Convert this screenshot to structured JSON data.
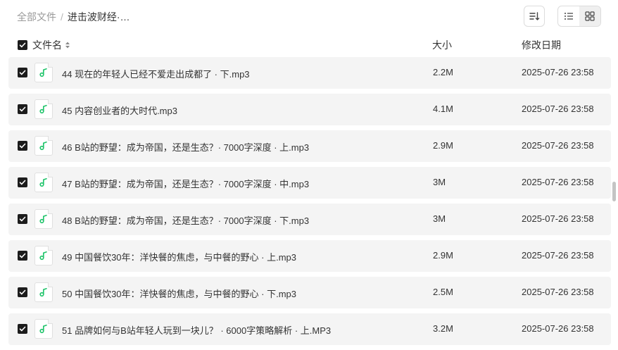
{
  "breadcrumb": {
    "root": "全部文件",
    "separator": "/",
    "current": "进击波财经·…"
  },
  "toolbar": {
    "sort_icon": "sort-icon",
    "view_list_icon": "list-view-icon",
    "view_grid_icon": "grid-view-icon",
    "active_view": "list"
  },
  "table": {
    "columns": {
      "name": "文件名",
      "size": "大小",
      "date": "修改日期"
    },
    "all_selected": true,
    "rows": [
      {
        "name": "44 现在的年轻人已经不爱走出成都了 · 下.mp3",
        "size": "2.2M",
        "date": "2025-07-26 23:58",
        "checked": true,
        "icon": "audio-file-icon"
      },
      {
        "name": "45 内容创业者的大时代.mp3",
        "size": "4.1M",
        "date": "2025-07-26 23:58",
        "checked": true,
        "icon": "audio-file-icon"
      },
      {
        "name": "46 B站的野望：成为帝国，还是生态？· 7000字深度 · 上.mp3",
        "size": "2.9M",
        "date": "2025-07-26 23:58",
        "checked": true,
        "icon": "audio-file-icon"
      },
      {
        "name": "47 B站的野望：成为帝国，还是生态？· 7000字深度 · 中.mp3",
        "size": "3M",
        "date": "2025-07-26 23:58",
        "checked": true,
        "icon": "audio-file-icon"
      },
      {
        "name": "48 B站的野望：成为帝国，还是生态？· 7000字深度 · 下.mp3",
        "size": "3M",
        "date": "2025-07-26 23:58",
        "checked": true,
        "icon": "audio-file-icon"
      },
      {
        "name": "49 中国餐饮30年：洋快餐的焦虑，与中餐的野心 · 上.mp3",
        "size": "2.9M",
        "date": "2025-07-26 23:58",
        "checked": true,
        "icon": "audio-file-icon"
      },
      {
        "name": "50 中国餐饮30年：洋快餐的焦虑，与中餐的野心 · 下.mp3",
        "size": "2.5M",
        "date": "2025-07-26 23:58",
        "checked": true,
        "icon": "audio-file-icon"
      },
      {
        "name": "51 品牌如何与B站年轻人玩到一块儿？ · 6000字策略解析 · 上.MP3",
        "size": "3.2M",
        "date": "2025-07-26 23:58",
        "checked": true,
        "icon": "audio-file-icon"
      }
    ]
  },
  "colors": {
    "checkbox": "#1c1c1c",
    "row_bg": "#f4f4f4",
    "music_icon": "#1fc46a"
  }
}
